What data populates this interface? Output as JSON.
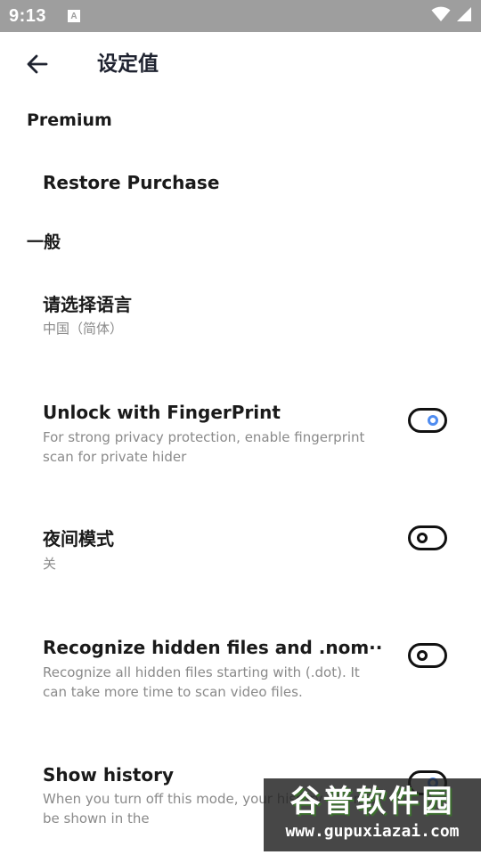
{
  "status_bar": {
    "time": "9:13",
    "notification_icon_label": "A",
    "icons": [
      "notification-icon",
      "wifi-icon",
      "cell-signal-icon"
    ]
  },
  "toolbar": {
    "title": "设定值",
    "back_icon": "arrow-back-icon"
  },
  "sections": {
    "premium": {
      "header": "Premium",
      "restore_purchase": "Restore Purchase"
    },
    "general": {
      "header": "一般",
      "language": {
        "title": "请选择语言",
        "summary": "中国（简体）"
      },
      "fingerprint": {
        "title": "Unlock with FingerPrint",
        "summary": "For strong privacy protection, enable fingerprint scan for private hider",
        "enabled": true
      },
      "night_mode": {
        "title": "夜间模式",
        "summary": "关",
        "enabled": false
      },
      "hidden_files": {
        "title": "Recognize hidden files and .nom··",
        "summary": "Recognize all hidden files starting with (.dot). It can take more time to scan video files.",
        "enabled": false
      },
      "show_history": {
        "title": "Show history",
        "summary": "When you turn off this mode, your history will not be shown in the",
        "enabled": true
      }
    }
  },
  "watermark": {
    "name": "谷普软件园",
    "url": "www.gupuxiazai.com"
  },
  "colors": {
    "status_bar": "#9e9e9e",
    "switch_on_knob": "#4f8cf0",
    "switch_outline": "#111111",
    "summary_text": "#8a8a8a"
  }
}
